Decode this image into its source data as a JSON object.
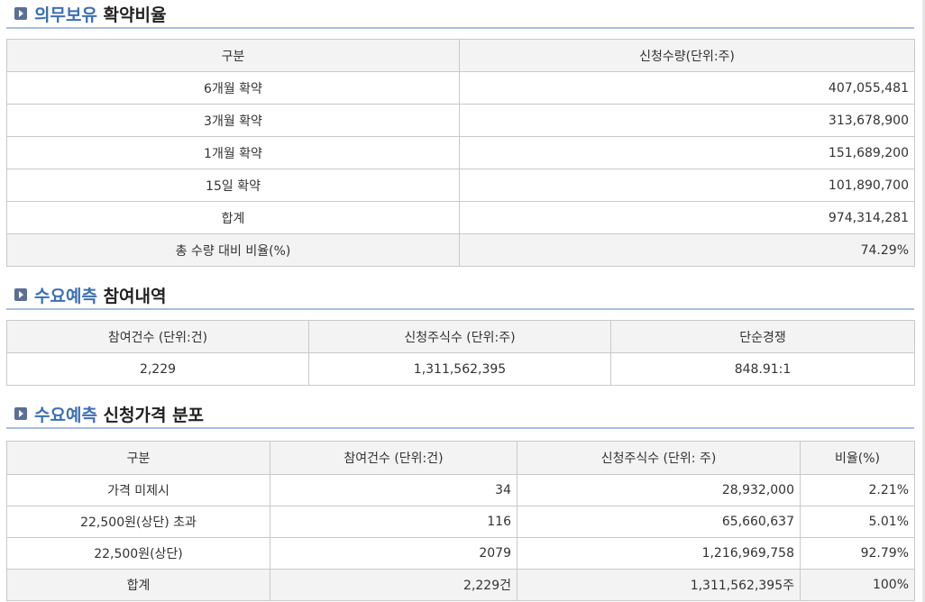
{
  "section1": {
    "title_accent": "의무보유",
    "title_rest": "확약비율",
    "headers": [
      "구분",
      "신청수량(단위:주)"
    ],
    "rows": [
      [
        "6개월 확약",
        "407,055,481"
      ],
      [
        "3개월 확약",
        "313,678,900"
      ],
      [
        "1개월 확약",
        "151,689,200"
      ],
      [
        "15일 확약",
        "101,890,700"
      ],
      [
        "합계",
        "974,314,281"
      ],
      [
        "총 수량 대비 비율(%)",
        "74.29%"
      ]
    ]
  },
  "section2": {
    "title_accent": "수요예측",
    "title_rest": "참여내역",
    "headers": [
      "참여건수 (단위:건)",
      "신청주식수 (단위:주)",
      "단순경쟁"
    ],
    "row": [
      "2,229",
      "1,311,562,395",
      "848.91:1"
    ]
  },
  "section3": {
    "title_accent": "수요예측",
    "title_rest": "신청가격 분포",
    "headers": [
      "구분",
      "참여건수 (단위:건)",
      "신청주식수 (단위: 주)",
      "비율(%)"
    ],
    "rows": [
      [
        "가격 미제시",
        "34",
        "28,932,000",
        "2.21%"
      ],
      [
        "22,500원(상단) 초과",
        "116",
        "65,660,637",
        "5.01%"
      ],
      [
        "22,500원(상단)",
        "2079",
        "1,216,969,758",
        "92.79%"
      ],
      [
        "합계",
        "2,229건",
        "1,311,562,395주",
        "100%"
      ]
    ]
  }
}
